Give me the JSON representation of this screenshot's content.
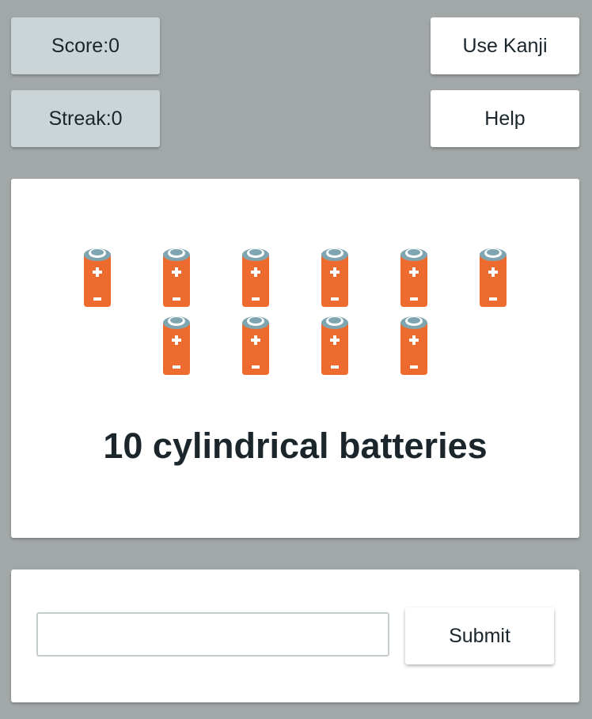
{
  "stats": {
    "score_label": "Score:",
    "score_value": "0",
    "streak_label": "Streak:",
    "streak_value": "0"
  },
  "buttons": {
    "kanji_label": "Use Kanji",
    "help_label": "Help",
    "submit_label": "Submit"
  },
  "question": {
    "item_count": 10,
    "item_icon": "battery-icon",
    "prompt": "10 cylindrical batteries"
  },
  "answer": {
    "value": "",
    "placeholder": ""
  },
  "colors": {
    "background": "#a2a7a7",
    "stat_box": "#cbd4d7",
    "battery_body": "#ee6b2f",
    "battery_cap": "#7fa6b0",
    "text": "#1b262c"
  }
}
